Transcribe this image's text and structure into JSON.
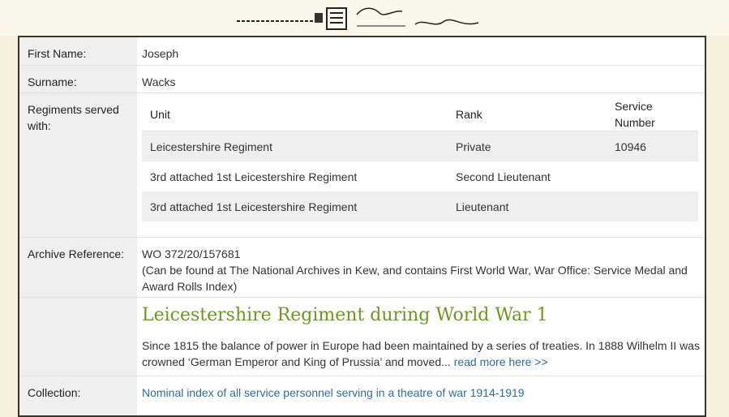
{
  "record": {
    "first_name_label": "First Name:",
    "first_name": "Joseph",
    "surname_label": "Surname:",
    "surname": "Wacks",
    "regiments_label": "Regiments served with:",
    "units_table": {
      "headers": [
        "Unit",
        "Rank",
        "Service Number"
      ],
      "rows": [
        [
          "Leicestershire Regiment",
          "Private",
          "10946"
        ],
        [
          "3rd attached 1st Leicestershire Regiment",
          "Second Lieutenant",
          ""
        ],
        [
          "3rd attached 1st Leicestershire Regiment",
          "Lieutenant",
          ""
        ]
      ]
    },
    "archive_label": "Archive Reference:",
    "archive_ref": "WO 372/20/157681",
    "archive_note": "(Can be found at The National Archives in Kew, and contains First World War, War Office: Service Medal and Award Rolls Index)",
    "article": {
      "title": "Leicestershire Regiment during World War 1",
      "text": "Since 1815 the balance of power in Europe had been maintained by a series of treaties. In 1888 Wilhelm II was crowned ‘German Emperor and King of Prussia’ and moved...",
      "read_more": "read more here  >>"
    },
    "collection_label": "Collection:",
    "collection_link": "Nominal index of all service personnel serving in a theatre of war 1914-1919"
  },
  "colors": {
    "accent_green": "#6a9a1c",
    "link_blue": "#2a6ea6",
    "label_bg": "#efefef",
    "page_bg": "#f6f0dc"
  }
}
